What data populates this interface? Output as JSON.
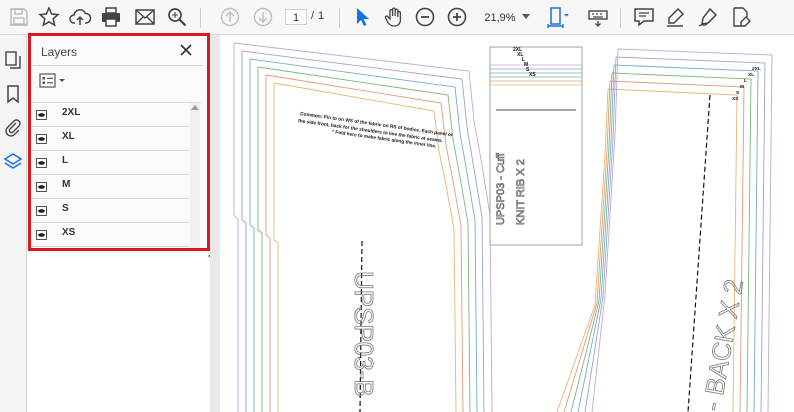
{
  "toolbar": {
    "page_current": "1",
    "page_separator": "/",
    "page_total": "1",
    "zoom_value": "21,9%"
  },
  "layers_panel": {
    "title": "Layers",
    "layers": [
      {
        "label": "2XL"
      },
      {
        "label": "XL"
      },
      {
        "label": "L"
      },
      {
        "label": "M"
      },
      {
        "label": "S"
      },
      {
        "label": "XS"
      }
    ]
  },
  "document": {
    "piece_left_label": "UPSP03-B",
    "piece_middle_label_1": "UPSP03 - Cuff",
    "piece_middle_label_2": "KNIT RIB  X 2",
    "piece_right_label": "- BACK X 2",
    "note_line_1": "Common: Pin to on WS of the fabric on RS of bodice. Each panel or",
    "note_line_2": "the side front, back for the shoulders to line the fabric at seams.",
    "note_line_3": "* Fold here to make fabric along the inner line.",
    "size_labels": [
      "2XL",
      "XL",
      "L",
      "M",
      "S",
      "XS"
    ],
    "size_codes": [
      "2XL",
      "XL",
      "L",
      "M",
      "S",
      "XS"
    ]
  },
  "colors": {
    "highlight": "#d7191f",
    "cursor_blue": "#1473e6",
    "size_line_colors": [
      "#c7a6c8",
      "#9ea0cf",
      "#6fb0c4",
      "#7ab87c",
      "#e19a7b",
      "#e7b66f"
    ]
  }
}
